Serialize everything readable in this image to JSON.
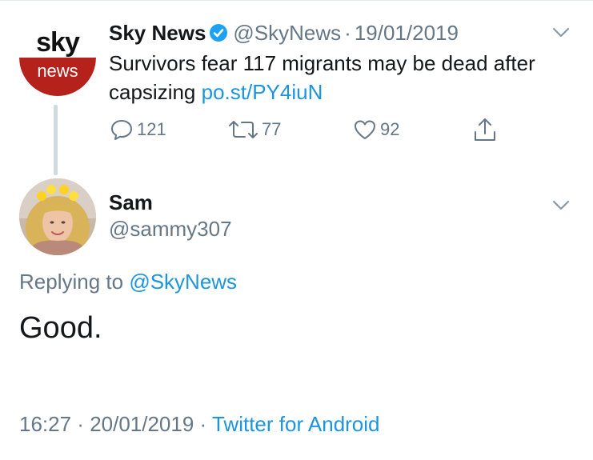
{
  "parent_tweet": {
    "avatar": {
      "logo_word_top": "sky",
      "logo_word_bottom": "news",
      "icon": "sky-news-logo-icon"
    },
    "display_name": "Sky News",
    "verified_icon": "verified-badge-icon",
    "handle": "@SkyNews",
    "separator": "·",
    "date": "19/01/2019",
    "text": "Survivors fear 117 migrants may be dead after capsizing ",
    "link": "po.st/PY4iuN",
    "actions": {
      "replies": "121",
      "retweets": "77",
      "likes": "92"
    }
  },
  "reply_tweet": {
    "display_name": "Sam",
    "handle": "@sammy307",
    "replying_prefix": "Replying to ",
    "replying_to": "@SkyNews",
    "text": "Good.",
    "time": "16:27",
    "separator1": " · ",
    "date": "20/01/2019",
    "separator2": " · ",
    "source": "Twitter for Android"
  },
  "colors": {
    "link": "#1b95e0",
    "muted": "#657786",
    "text": "#14171a",
    "sky_red": "#b5221c",
    "verified": "#1da1f2"
  }
}
